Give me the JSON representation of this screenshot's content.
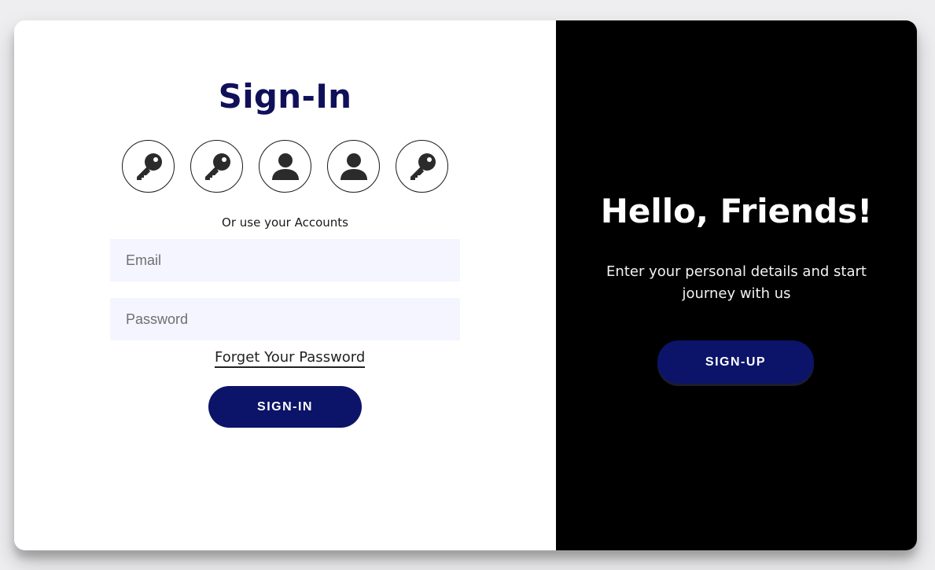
{
  "sign_in": {
    "title": "Sign-In",
    "social_icons": [
      "key-icon",
      "key-icon",
      "user-icon",
      "user-icon",
      "key-icon"
    ],
    "or_text": "Or use your Accounts",
    "email_placeholder": "Email",
    "password_placeholder": "Password",
    "forgot_label": "Forget Your Password",
    "button_label": "SIGN-IN"
  },
  "overlay": {
    "title": "Hello, Friends!",
    "subtitle": "Enter your personal details and start journey with us",
    "button_label": "SIGN-UP"
  },
  "colors": {
    "title": "#10105a",
    "button": "#0b1468",
    "field_bg": "#f4f5ff",
    "panel_bg": "#000000"
  }
}
